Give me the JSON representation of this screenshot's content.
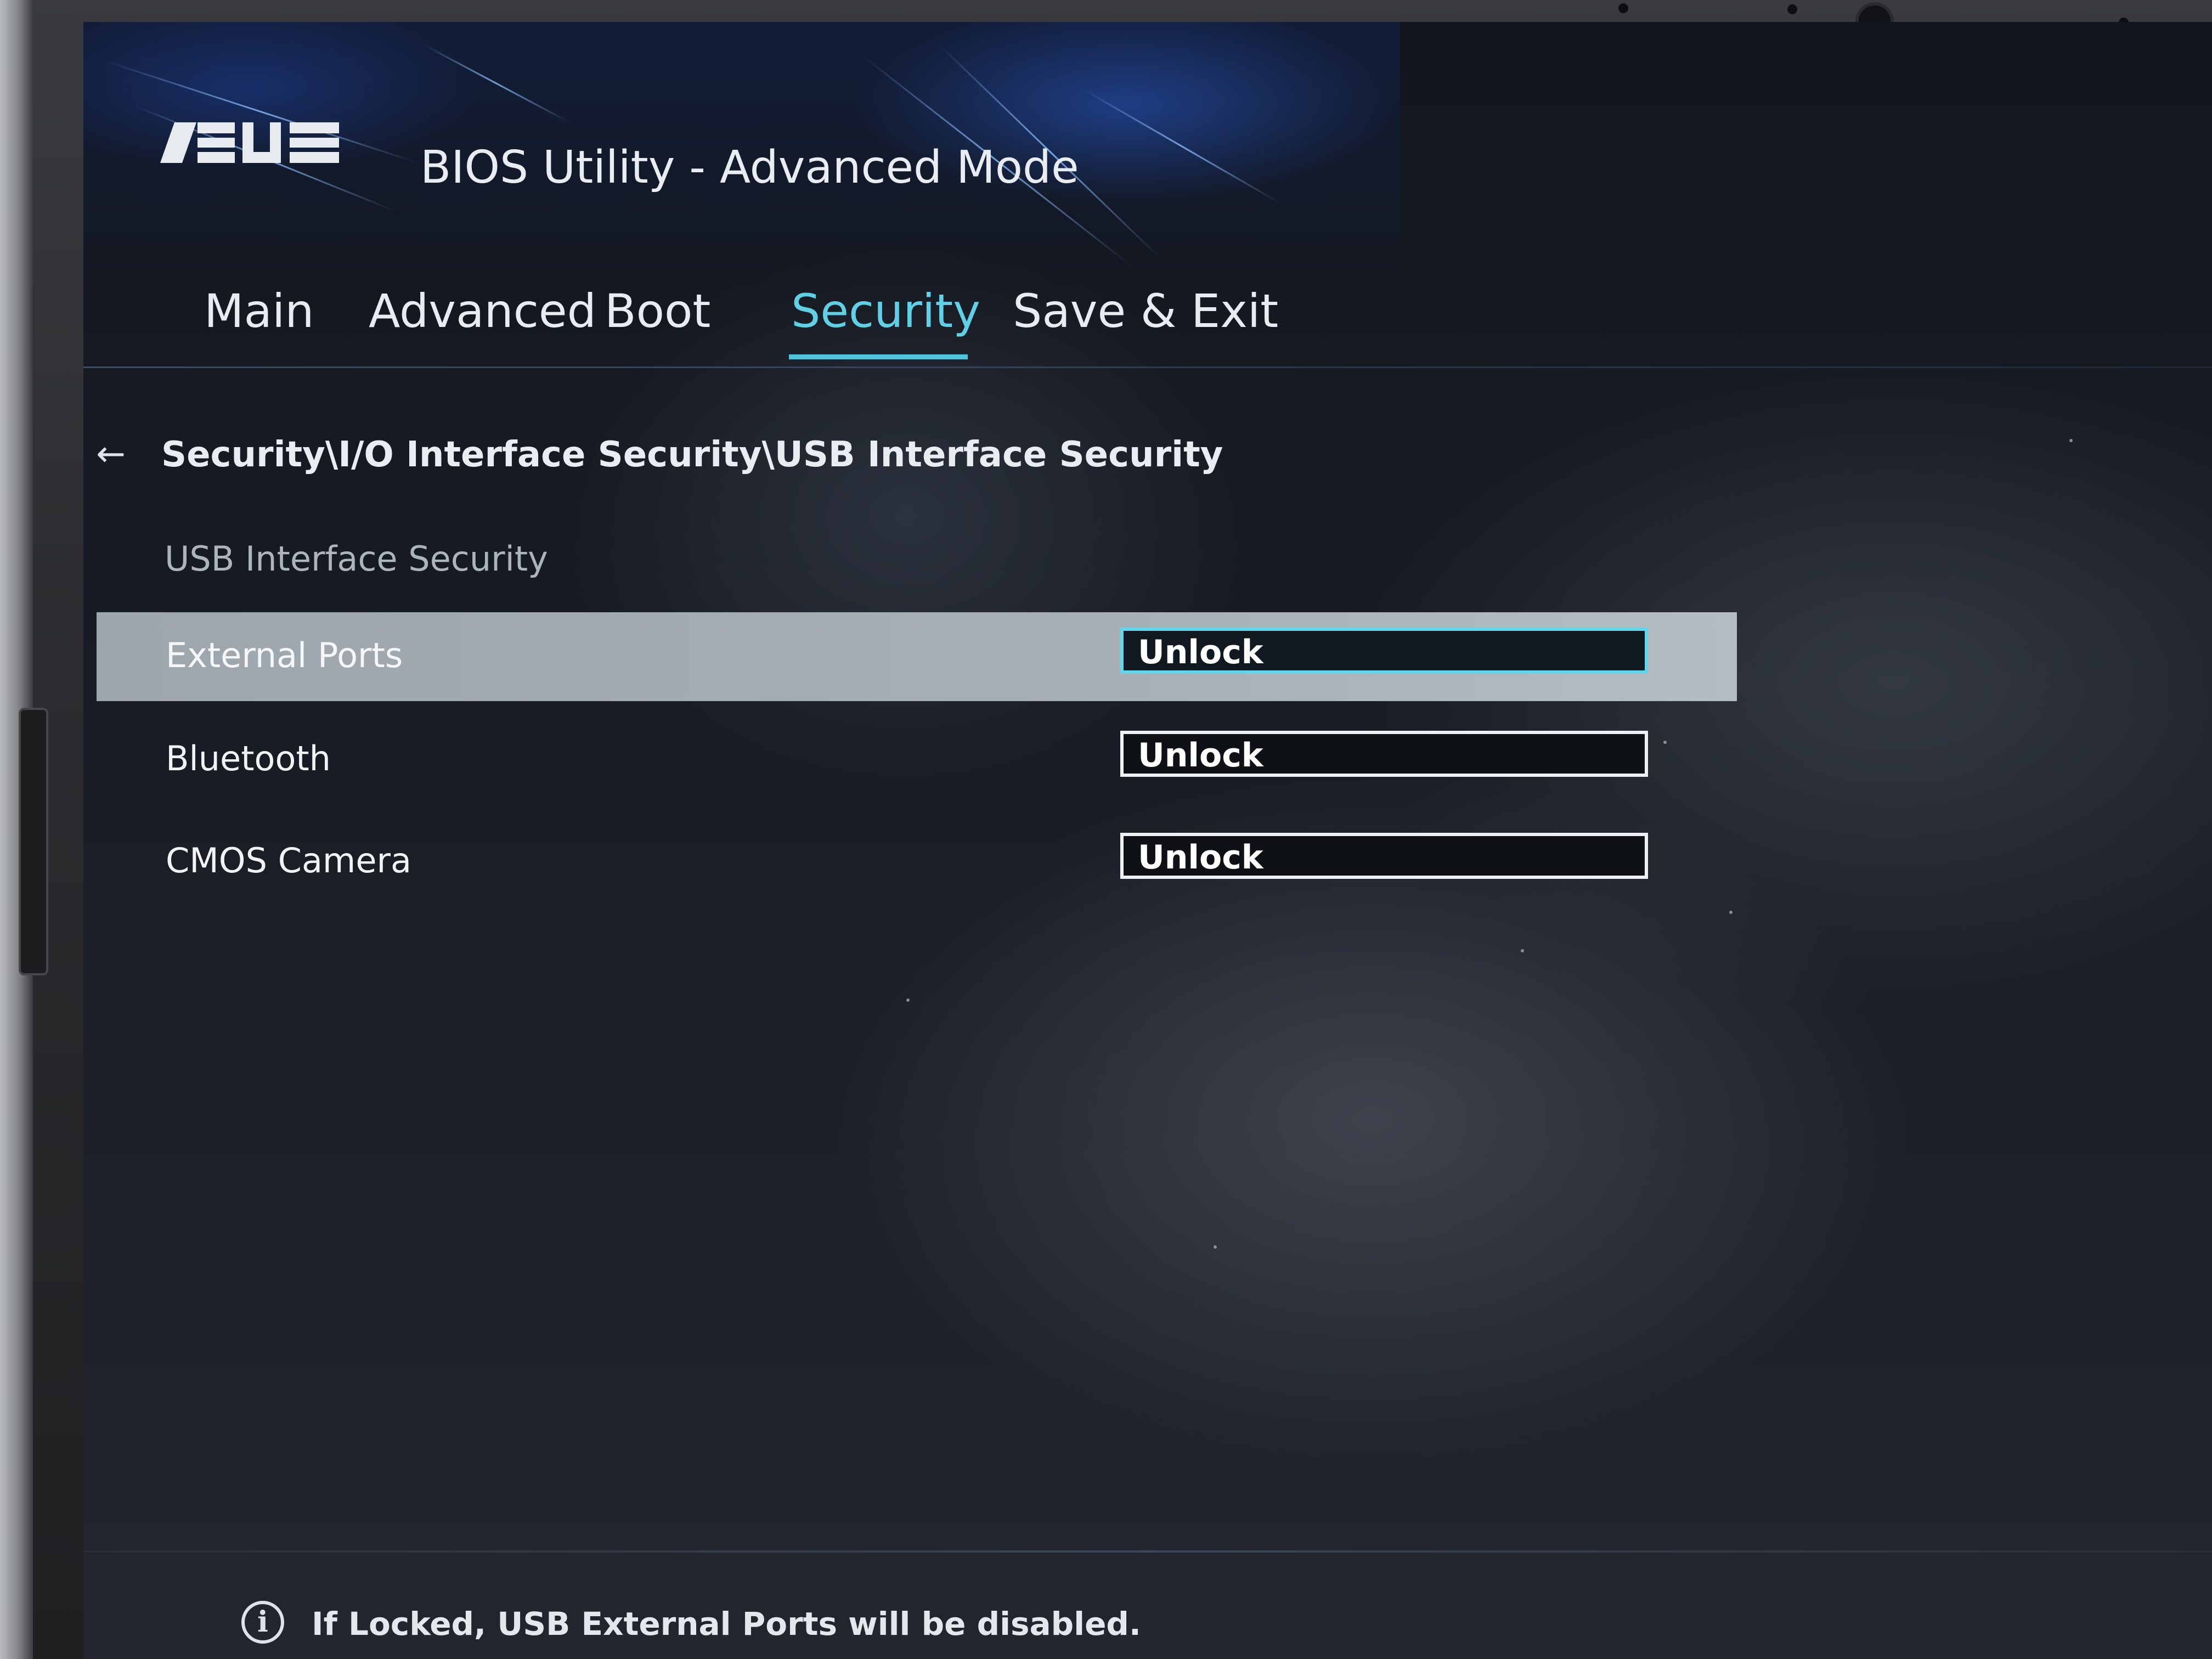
{
  "app": {
    "brand": "ASUS",
    "title": "BIOS Utility - Advanced Mode"
  },
  "tabs": [
    {
      "label": "Main",
      "active": false
    },
    {
      "label": "Advanced",
      "active": false
    },
    {
      "label": "Boot",
      "active": false
    },
    {
      "label": "Security",
      "active": true
    },
    {
      "label": "Save & Exit",
      "active": false
    }
  ],
  "breadcrumb": {
    "back_icon": "arrow-left-icon",
    "path": "Security\\I/O Interface Security\\USB Interface Security"
  },
  "section": {
    "title": "USB Interface Security"
  },
  "settings": [
    {
      "label": "External Ports",
      "value": "Unlock",
      "selected": true
    },
    {
      "label": "Bluetooth",
      "value": "Unlock",
      "selected": false
    },
    {
      "label": "CMOS Camera",
      "value": "Unlock",
      "selected": false
    }
  ],
  "footer": {
    "info_icon": "info-icon",
    "help_text": "If Locked, USB External Ports will be disabled."
  },
  "colors": {
    "accent": "#5fd0e6",
    "selected_row": "#a7afb5",
    "text": "#e9edf2"
  }
}
